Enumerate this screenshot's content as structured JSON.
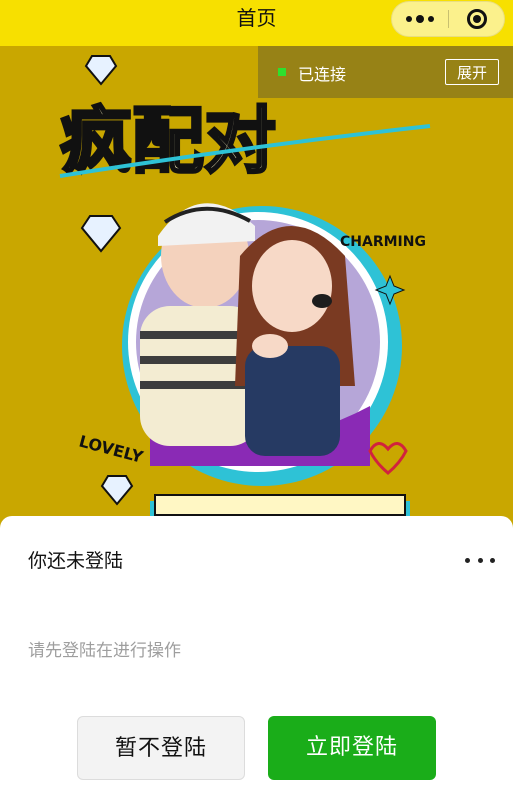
{
  "navbar": {
    "title": "首页",
    "capsule": {
      "more_icon": "more-dots-icon",
      "close_icon": "target-close-icon"
    }
  },
  "connection": {
    "status": "已连接",
    "status_color": "#2ee02e",
    "expand_label": "展开"
  },
  "poster": {
    "headline": "疯配对",
    "tag_charming": "CHARMING",
    "tag_lovely": "LOVELY"
  },
  "dialog": {
    "title": "你还未登陆",
    "message": "请先登陆在进行操作",
    "cancel_label": "暂不登陆",
    "confirm_label": "立即登陆",
    "confirm_color": "#1aad19"
  },
  "colors": {
    "nav_bg": "#f7e000",
    "poster_bg": "#c9a700"
  }
}
